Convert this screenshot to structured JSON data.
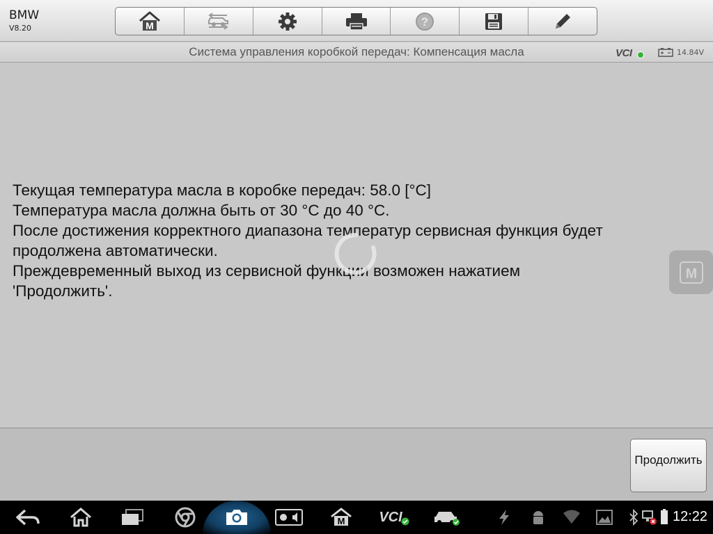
{
  "app": {
    "make": "BMW",
    "version": "V8.20"
  },
  "toolbar": {
    "buttons": [
      {
        "name": "home-button",
        "icon": "home-m-icon"
      },
      {
        "name": "vehicle-swap-button",
        "icon": "car-swap-icon"
      },
      {
        "name": "settings-button",
        "icon": "gear-icon"
      },
      {
        "name": "print-button",
        "icon": "printer-icon"
      },
      {
        "name": "help-button",
        "icon": "question-icon"
      },
      {
        "name": "save-button",
        "icon": "floppy-icon"
      },
      {
        "name": "edit-button",
        "icon": "pencil-icon"
      }
    ]
  },
  "header": {
    "title": "Система управления коробкой передач: Компенсация масла",
    "vci_label": "VCI",
    "voltage": "14.84V"
  },
  "main": {
    "lines": [
      "Текущая температура масла в коробке передач: 58.0 [°C]",
      "Температура масла должна быть от 30 °C до 40 °C.",
      "После достижения корректного диапазона температур сервисная функция будет",
      "продолжена автоматически.",
      "Преждевременный выход из сервисной функции возможен нажатием",
      "'Продолжить'."
    ],
    "floating_button_letter": "M"
  },
  "actions": {
    "continue_label": "Продолжить"
  },
  "navbar": {
    "vci_label": "VCI",
    "m_label": "M",
    "clock": "12:22"
  },
  "colors": {
    "background": "#c8c8c8",
    "ok_green": "#38b33a",
    "navbar_bg": "#000000",
    "camera_highlight": "#1f5f8e"
  }
}
